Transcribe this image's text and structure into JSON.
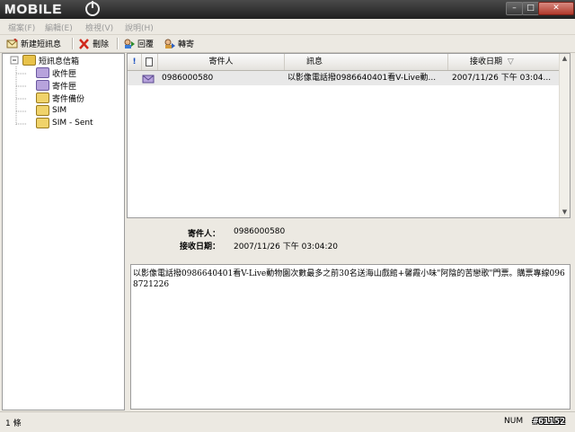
{
  "app": {
    "logo_text": "MOBILE"
  },
  "window_controls": {
    "minimize": "–",
    "maximize": "□",
    "close": "✕"
  },
  "menubar": [
    {
      "label": "檔案(F)"
    },
    {
      "label": "編輯(E)"
    },
    {
      "label": "檢視(V)"
    },
    {
      "label": "說明(H)"
    }
  ],
  "toolbar": {
    "new_label": "新建短訊息",
    "delete_label": "刪除",
    "reply_label": "回覆",
    "forward_label": "轉寄"
  },
  "tree": {
    "root": "短訊息信箱",
    "items": [
      {
        "label": "收件匣",
        "icon": "inbox-icon"
      },
      {
        "label": "寄件匣",
        "icon": "outbox-icon"
      },
      {
        "label": "寄件備份",
        "icon": "sent-backup-icon"
      },
      {
        "label": "SIM",
        "icon": "sim-icon"
      },
      {
        "label": "SIM - Sent",
        "icon": "sim-sent-icon"
      }
    ]
  },
  "list": {
    "columns": {
      "priority": "!",
      "type": "",
      "sender": "寄件人",
      "message": "訊息",
      "date": "接收日期",
      "sort_indicator": "▽"
    },
    "rows": [
      {
        "sender": "0986000580",
        "message": "以影像電話撥0986640401看V-Live動...",
        "date": "2007/11/26 下午 03:04..."
      }
    ]
  },
  "detail": {
    "sender_label": "寄件人：",
    "sender_value": "0986000580",
    "date_label": "接收日期：",
    "date_value": "2007/11/26 下午 03:04:20",
    "body": "以影像電話撥0986640401看V-Live動物園次數最多之前30名送海山戲館+馨霞小味\"阿陰的苦戀歌\"門票。購票專線0968721226"
  },
  "statusbar": {
    "count": "1 條",
    "num": "NUM",
    "watermark": "#61152"
  },
  "colors": {
    "titlebar": "#2a2a2a",
    "close_button": "#c0392b",
    "window_bg": "#ece9e2",
    "selected_row": "#e8e8e8"
  }
}
